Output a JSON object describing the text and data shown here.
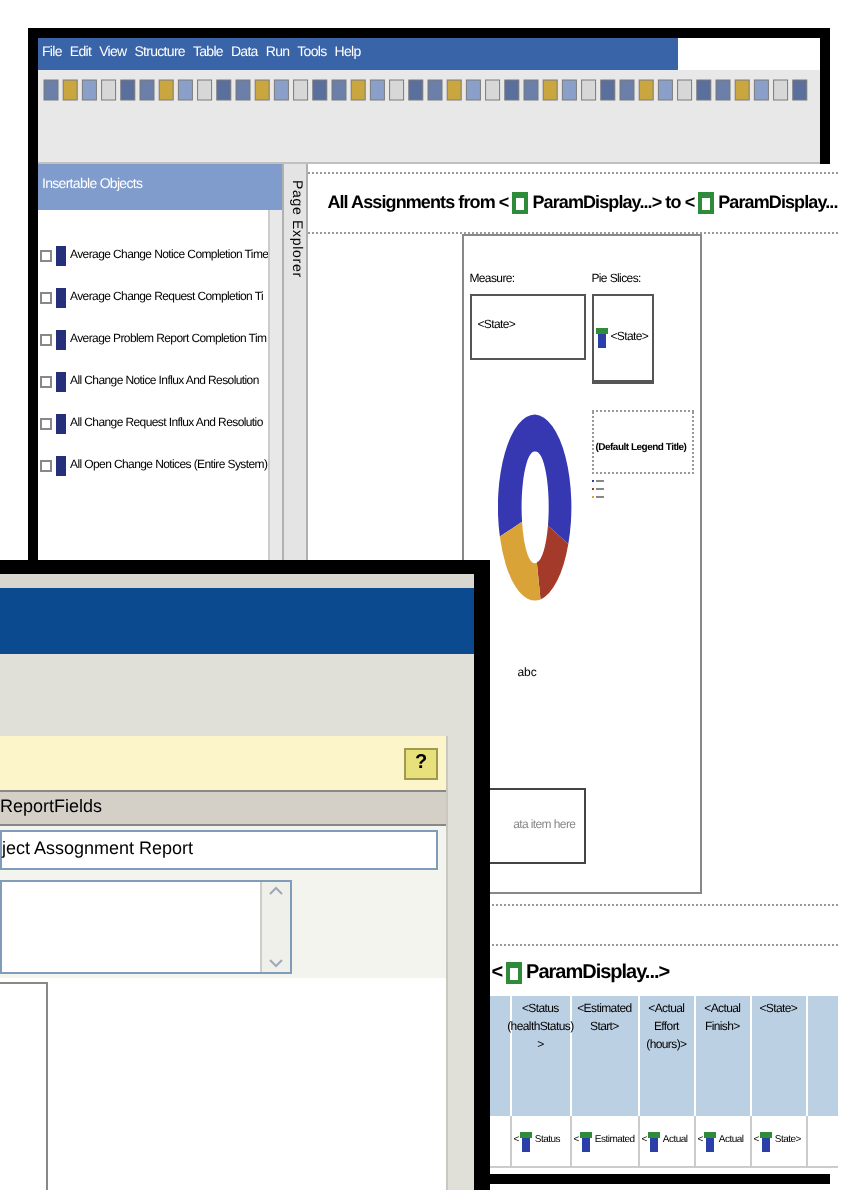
{
  "back_window": {
    "menu": [
      "File",
      "Edit",
      "View",
      "Structure",
      "Table",
      "Data",
      "Run",
      "Tools",
      "Help"
    ],
    "insertable_objects": {
      "title": "Insertable Objects",
      "items": [
        {
          "label": "Average Change Notice Completion Time"
        },
        {
          "label": "Average Change Request Completion Ti"
        },
        {
          "label": "Average Problem Report Completion Tim"
        },
        {
          "label": "All Change Notice Influx And Resolution"
        },
        {
          "label": "All Change Request Influx And Resolutio"
        },
        {
          "label": "All Open Change Notices (Entire System)"
        }
      ]
    },
    "side_tab": "Page Explorer",
    "report": {
      "title": {
        "prefix": "All Assignments from <",
        "param_1": "ParamDisplay...>",
        "middle": "to <",
        "param_2": "ParamDisplay..."
      },
      "chart": {
        "measure_label": "Measure:",
        "measure_value": "<State>",
        "pie_slices_label": "Pie Slices:",
        "pie_slices_value": "<State>",
        "legend_title": "(Default Legend Title)",
        "label": "abc",
        "drop_hint": "ata item here"
      },
      "list_title": {
        "prefix": "<",
        "param": "ParamDisplay...>"
      },
      "table": {
        "columns": [
          "<Status (healthStatus) >",
          "<Estimated Start>",
          "<Actual Effort (hours)>",
          "<Actual Finish>",
          "<State>"
        ],
        "row": [
          {
            "lead": "<",
            "text": "Status"
          },
          {
            "lead": "<",
            "text": "Estimated"
          },
          {
            "lead": "<",
            "text": "Actual"
          },
          {
            "lead": "<",
            "text": "Actual"
          },
          {
            "lead": "<",
            "text": "State>"
          }
        ]
      }
    }
  },
  "front_window": {
    "help_button": "?",
    "section_header": "ReportFields",
    "name_field": "ject Assognment Report"
  }
}
